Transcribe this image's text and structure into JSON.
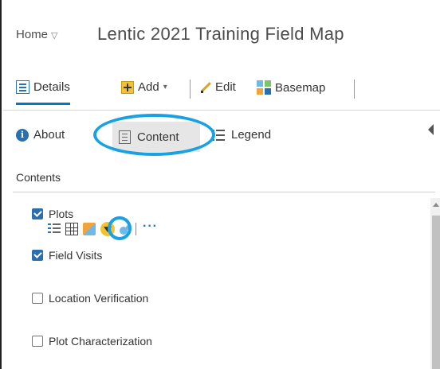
{
  "header": {
    "home_label": "Home",
    "home_chevron": "▽",
    "title": "Lentic 2021 Training Field Map"
  },
  "toolbar": {
    "details_label": "Details",
    "add_label": "Add",
    "add_caret": "▾",
    "edit_label": "Edit",
    "basemap_label": "Basemap"
  },
  "tabs": [
    {
      "label": "About",
      "icon": "info-icon"
    },
    {
      "label": "Content",
      "icon": "content-icon"
    },
    {
      "label": "Legend",
      "icon": "legend-icon"
    }
  ],
  "contents": {
    "heading": "Contents",
    "layers": [
      {
        "label": "Plots",
        "checked": true
      },
      {
        "label": "Field Visits",
        "checked": true
      },
      {
        "label": "Location Verification",
        "checked": false
      },
      {
        "label": "Plot Characterization",
        "checked": false
      }
    ],
    "layer_tools": [
      "show-item-details-icon",
      "show-table-icon",
      "change-style-icon",
      "filter-icon",
      "perform-analysis-icon",
      "more-options-icon"
    ],
    "more_label": "···"
  },
  "colors": {
    "accent": "#0079c1",
    "highlight": "#1ba1e2",
    "checkbox": "#2a6fb0"
  }
}
